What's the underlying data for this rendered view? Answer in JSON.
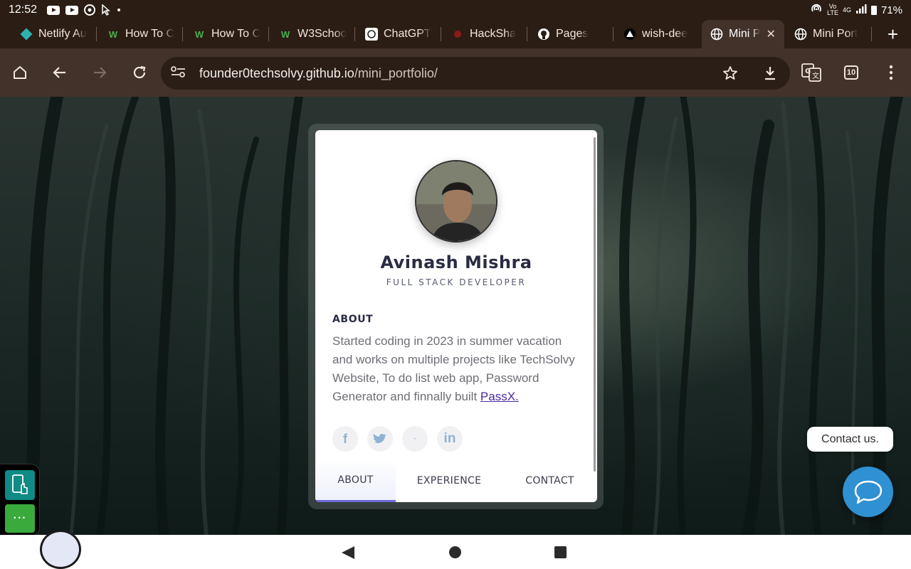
{
  "status": {
    "time": "12:52",
    "network_top": "4G",
    "carrier_top": "Vo",
    "carrier_bottom": "LTE",
    "battery": "71%"
  },
  "tabs": [
    {
      "label": "Netlify Au",
      "icon": "netlify-icon"
    },
    {
      "label": "How To C",
      "icon": "w3-icon"
    },
    {
      "label": "How To C",
      "icon": "w3-icon"
    },
    {
      "label": "W3Schoo",
      "icon": "w3-icon"
    },
    {
      "label": "ChatGPT",
      "icon": "chatgpt-icon"
    },
    {
      "label": "HackSha",
      "icon": "hackshala-icon"
    },
    {
      "label": "Pages",
      "icon": "github-icon"
    },
    {
      "label": "wish-dee",
      "icon": "triangle-icon"
    },
    {
      "label": "Mini P",
      "icon": "globe-icon",
      "active": true
    },
    {
      "label": "Mini Port",
      "icon": "globe-icon"
    }
  ],
  "toolbar": {
    "url_host": "founder0techsolvy.github.io",
    "url_path": "/mini_portfolio/",
    "tab_count": "10"
  },
  "card": {
    "name": "Avinash Mishra",
    "role": "FULL STACK DEVELOPER",
    "about_heading": "ABOUT",
    "about_text": "Started coding in 2023 in summer vacation and works on multiple projects like TechSolvy Website, To do list web app, Password Generator and finnally built ",
    "about_link": "PassX.",
    "socials": [
      "facebook-icon",
      "twitter-icon",
      "dot-icon",
      "linkedin-icon"
    ],
    "tabs": [
      "ABOUT",
      "EXPERIENCE",
      "CONTACT"
    ],
    "active_tab": "ABOUT"
  },
  "contact_bubble": "Contact us.",
  "dock": {
    "more_label": "···"
  },
  "colors": {
    "browser_bg": "#42322a",
    "tab_strip": "#2b1d13",
    "accent": "#6e6bd6",
    "chat": "#2f90d2"
  }
}
